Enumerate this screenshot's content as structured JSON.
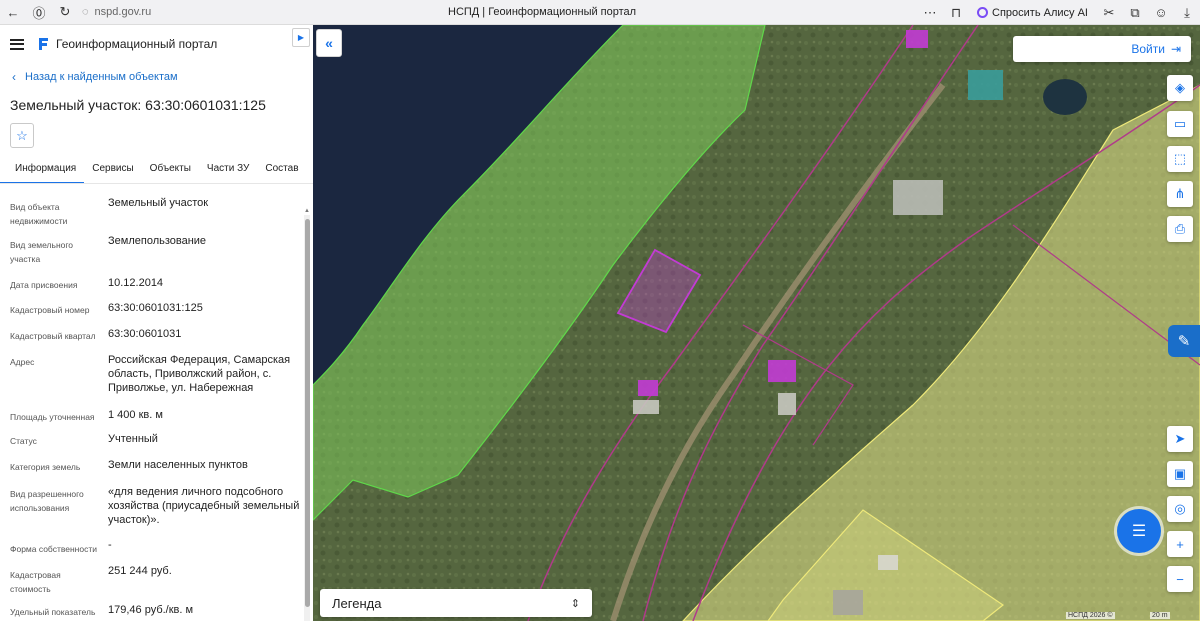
{
  "browser": {
    "url": "nspd.gov.ru",
    "tab_title": "НСПД | Геоинформационный портал",
    "alice_label": "Спросить Алису AI"
  },
  "header": {
    "portal_title": "Геоинформационный портал"
  },
  "panel": {
    "back_link": "Назад к найденным объектам",
    "object_title": "Земельный участок: 63:30:0601031:125",
    "tabs": [
      {
        "label": "Информация",
        "active": true
      },
      {
        "label": "Сервисы"
      },
      {
        "label": "Объекты"
      },
      {
        "label": "Части ЗУ"
      },
      {
        "label": "Состав"
      }
    ],
    "attributes": [
      {
        "label": "Вид объекта недвижимости",
        "value": "Земельный участок"
      },
      {
        "label": "Вид земельного участка",
        "value": "Землепользование"
      },
      {
        "label": "Дата присвоения",
        "value": "10.12.2014"
      },
      {
        "label": "Кадастровый номер",
        "value": "63:30:0601031:125"
      },
      {
        "label": "Кадастровый квартал",
        "value": "63:30:0601031"
      },
      {
        "label": "Адрес",
        "value": "Российская Федерация, Самарская область, Приволжский район, с. Приволжье, ул. Набережная"
      },
      {
        "label": "Площадь уточненная",
        "value": "1 400 кв. м"
      },
      {
        "label": "Статус",
        "value": "Учтенный"
      },
      {
        "label": "Категория земель",
        "value": "Земли населенных пунктов"
      },
      {
        "label": "Вид разрешенного использования",
        "value": "«для ведения личного подсобного хозяйства (приусадебный земельный участок)»."
      },
      {
        "label": "Форма собственности",
        "value": "-"
      },
      {
        "label": "Кадастровая стоимость",
        "value": "251 244 руб."
      },
      {
        "label": "Удельный показатель",
        "value": "179,46 руб./кв. м"
      }
    ]
  },
  "map": {
    "login_label": "Войти",
    "legend_label": "Легенда",
    "attribution": "НСПД 2026 ©",
    "scale": "20 m",
    "tools": [
      "layers-icon",
      "ruler-icon",
      "select-area-icon",
      "share-icon",
      "print-icon"
    ],
    "nav_tools": [
      "locate-icon",
      "basemap-icon",
      "geolocation-icon",
      "zoom-in-icon",
      "zoom-out-icon"
    ],
    "colors": {
      "selected_parcel": "#c23bd4",
      "boundary": "#b03a8a",
      "river": "#1b2740",
      "green_zone": "#7ec85b",
      "yellow_zone": "#e6e58a"
    }
  }
}
